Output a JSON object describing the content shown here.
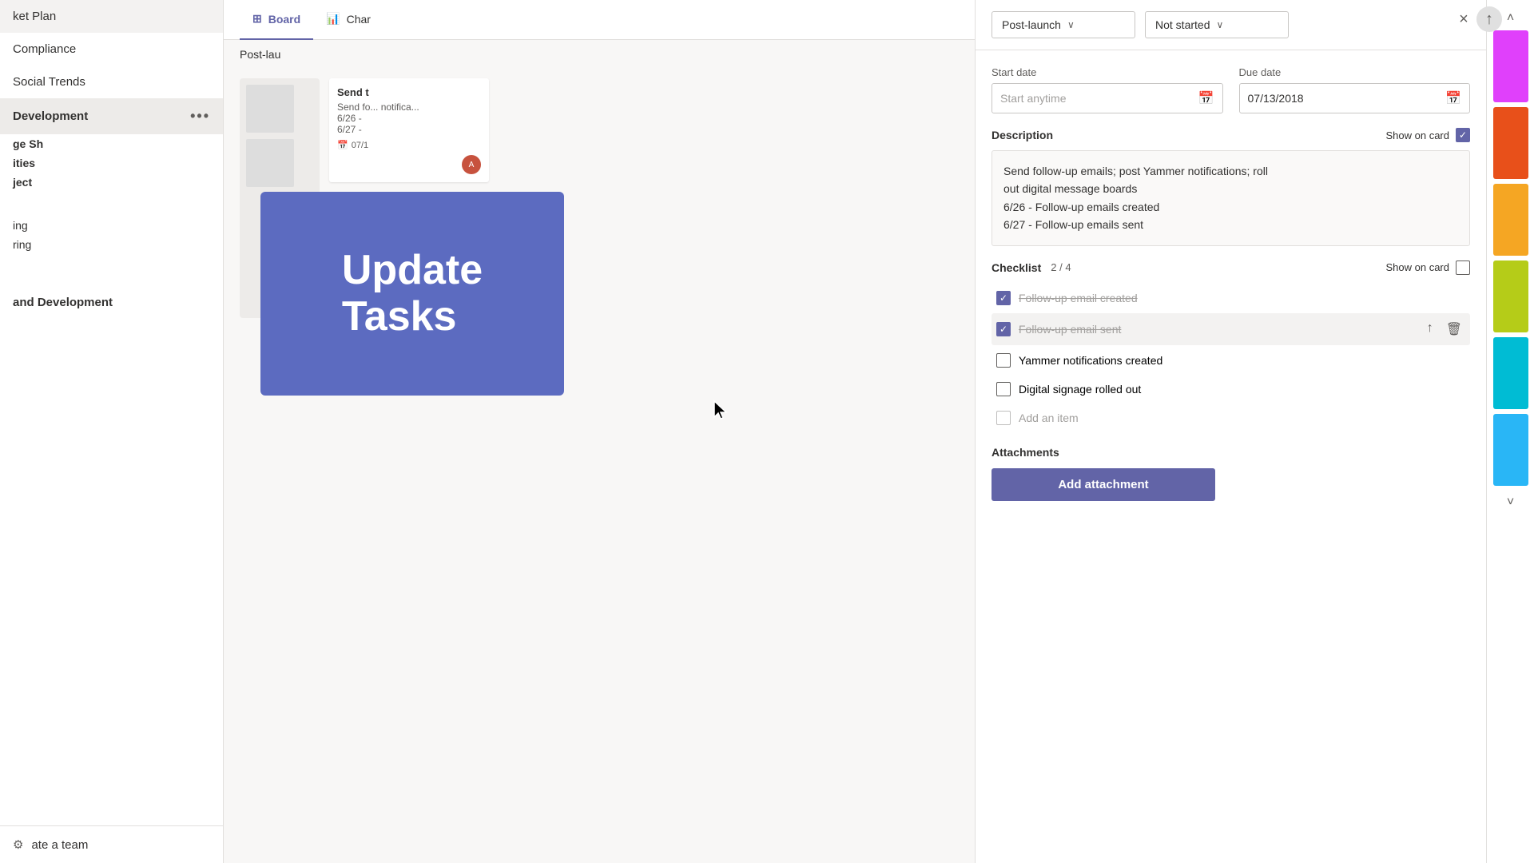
{
  "sidebar": {
    "items": [
      {
        "id": "market-plan",
        "label": "ket Plan",
        "active": false
      },
      {
        "id": "compliance",
        "label": "Compliance",
        "active": false
      },
      {
        "id": "social-trends",
        "label": "Social Trends",
        "active": false
      },
      {
        "id": "development",
        "label": "Development",
        "active": true,
        "hasDots": true
      }
    ],
    "section_groups": [
      {
        "id": "ge-sh",
        "label": "ge Sh"
      },
      {
        "id": "ities",
        "label": "ities"
      },
      {
        "id": "ject",
        "label": "ject"
      }
    ],
    "bottom_items": [
      {
        "id": "ing",
        "label": "ing"
      },
      {
        "id": "ring",
        "label": "ring"
      }
    ],
    "band_and_dev": "and Development",
    "create_team": "ate a team"
  },
  "board": {
    "tabs": [
      {
        "id": "board",
        "label": "Board",
        "icon": "grid"
      },
      {
        "id": "chart",
        "label": "Char",
        "icon": "chart"
      }
    ],
    "board_label": "Post-lau"
  },
  "task_card": {
    "title": "Send t",
    "desc": "Send fo... notifica...",
    "line1": "6/26 -",
    "line2": "6/27 -",
    "date": "07/1"
  },
  "update_overlay": {
    "line1": "Update",
    "line2": "Tasks"
  },
  "panel": {
    "dropdown1": {
      "value": "Post-launch",
      "placeholder": "Post-launch"
    },
    "dropdown2": {
      "value": "Not started",
      "placeholder": "Not started"
    },
    "start_date": {
      "label": "Start date",
      "placeholder": "Start anytime"
    },
    "due_date": {
      "label": "Due date",
      "value": "07/13/2018"
    },
    "description": {
      "label": "Description",
      "show_on_card": "Show on card",
      "text_line1": "Send follow-up emails; post Yammer notifications; roll",
      "text_line2": "out digital message boards",
      "text_line3": "6/26 - Follow-up emails created",
      "text_line4": "6/27 - Follow-up emails sent"
    },
    "checklist": {
      "label": "Checklist",
      "progress": "2 / 4",
      "show_on_card": "Show on card",
      "items": [
        {
          "id": "item1",
          "text": "Follow-up email created",
          "checked": true,
          "completed": true
        },
        {
          "id": "item2",
          "text": "Follow-up email sent",
          "checked": true,
          "completed": true,
          "active": true
        },
        {
          "id": "item3",
          "text": "Yammer notifications created",
          "checked": false,
          "completed": false
        },
        {
          "id": "item4",
          "text": "Digital signage rolled out",
          "checked": false,
          "completed": false
        }
      ],
      "add_item_placeholder": "Add an item"
    },
    "attachments": {
      "label": "Attachments",
      "add_button": "Add attachment"
    }
  },
  "color_swatches": [
    {
      "id": "magenta",
      "color": "#e040fb"
    },
    {
      "id": "red-orange",
      "color": "#e8501a"
    },
    {
      "id": "orange",
      "color": "#f5a623"
    },
    {
      "id": "yellow-green",
      "color": "#b5cc18"
    },
    {
      "id": "teal",
      "color": "#00bcd4"
    },
    {
      "id": "cyan",
      "color": "#00b4d8"
    }
  ],
  "icons": {
    "board": "⊞",
    "chart": "📊",
    "calendar": "📅",
    "checkmark": "✓",
    "up_arrow": "↑",
    "delete": "🗑",
    "chevron_down": "⌄",
    "chevron_up": "⌃",
    "gear": "⚙",
    "ellipsis": "•••",
    "close": "×",
    "scroll_up": "˄",
    "scroll_down": "˅"
  }
}
